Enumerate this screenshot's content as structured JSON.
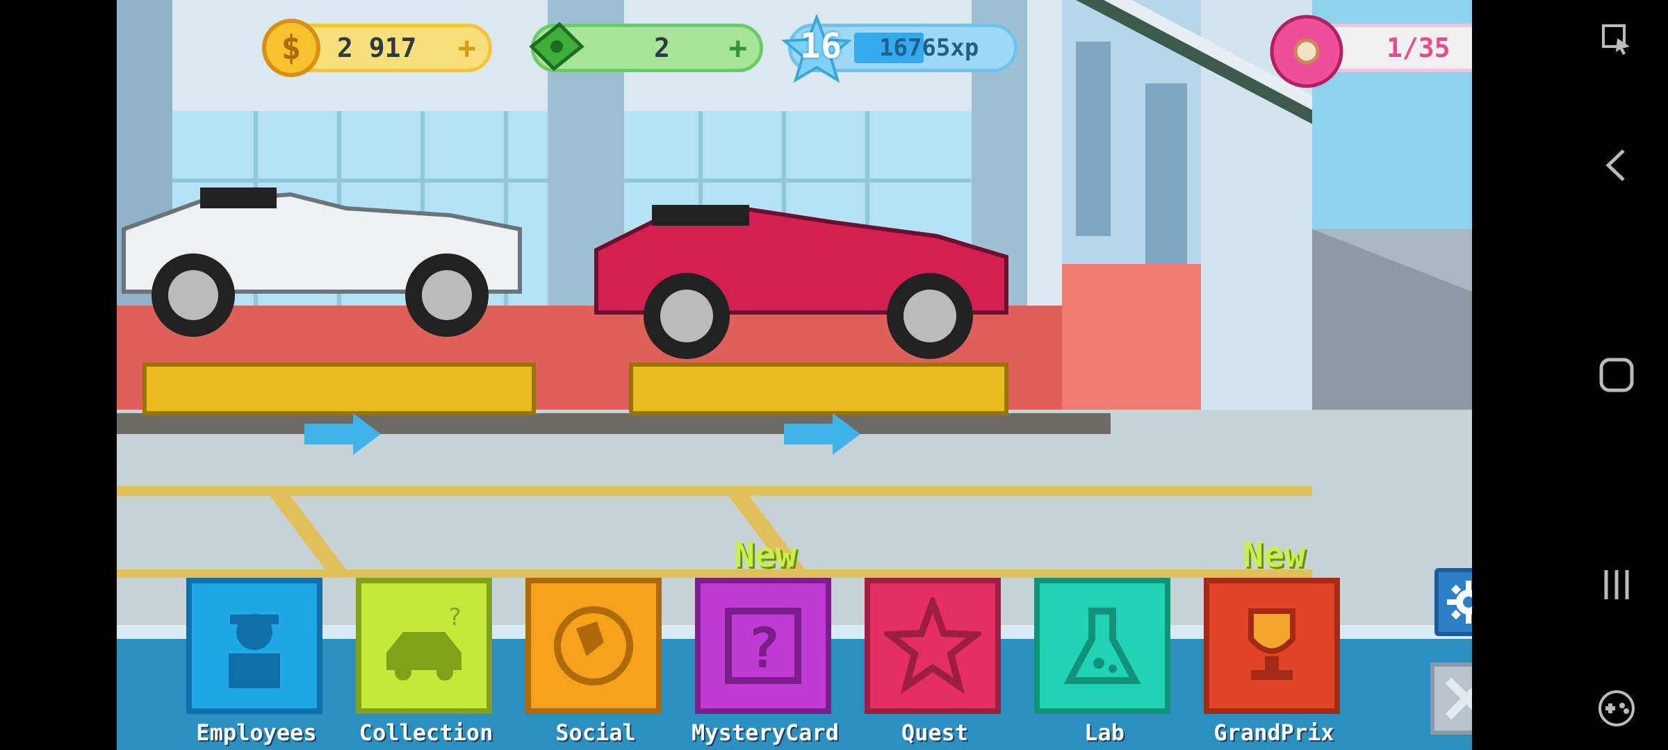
{
  "hud": {
    "coins": "2 917",
    "cash": "2",
    "level": "16",
    "xp": "16765xp",
    "donuts": "1/35",
    "plus": "+"
  },
  "menu": [
    {
      "label": "Employees",
      "color": "#1ea9e6",
      "border": "#0f6fa8"
    },
    {
      "label": "Collection",
      "color": "#c6e83a",
      "border": "#7fa11b"
    },
    {
      "label": "Social",
      "color": "#f4a21b",
      "border": "#b06a0b"
    },
    {
      "label": "MysteryCard",
      "color": "#c23ad6",
      "border": "#7a1f8a",
      "badge": "New"
    },
    {
      "label": "Quest",
      "color": "#e52e64",
      "border": "#9c1e43"
    },
    {
      "label": "Lab",
      "color": "#1fd3b4",
      "border": "#119279"
    },
    {
      "label": "GrandPrix",
      "color": "#e24427",
      "border": "#a02a16",
      "badge": "New"
    }
  ],
  "icons": {
    "coin": "coin-icon",
    "cash": "cash-icon",
    "level": "star-icon",
    "donut": "donut-icon",
    "settings": "gear-icon",
    "close": "close-icon"
  }
}
